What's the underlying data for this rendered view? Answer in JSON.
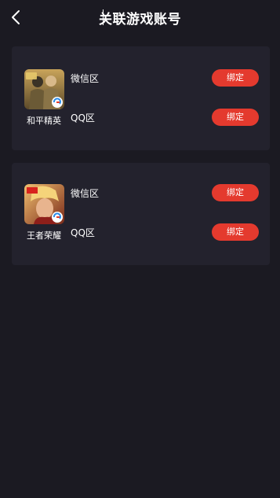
{
  "header": {
    "title": "关联游戏账号"
  },
  "games": [
    {
      "name": "和平精英",
      "rows": [
        {
          "zone": "微信区",
          "button": "绑定"
        },
        {
          "zone": "QQ区",
          "button": "绑定"
        }
      ]
    },
    {
      "name": "王者荣耀",
      "rows": [
        {
          "zone": "微信区",
          "button": "绑定"
        },
        {
          "zone": "QQ区",
          "button": "绑定"
        }
      ]
    }
  ],
  "colors": {
    "background": "#1b1a22",
    "card": "#23222d",
    "accent": "#e43a2e"
  }
}
